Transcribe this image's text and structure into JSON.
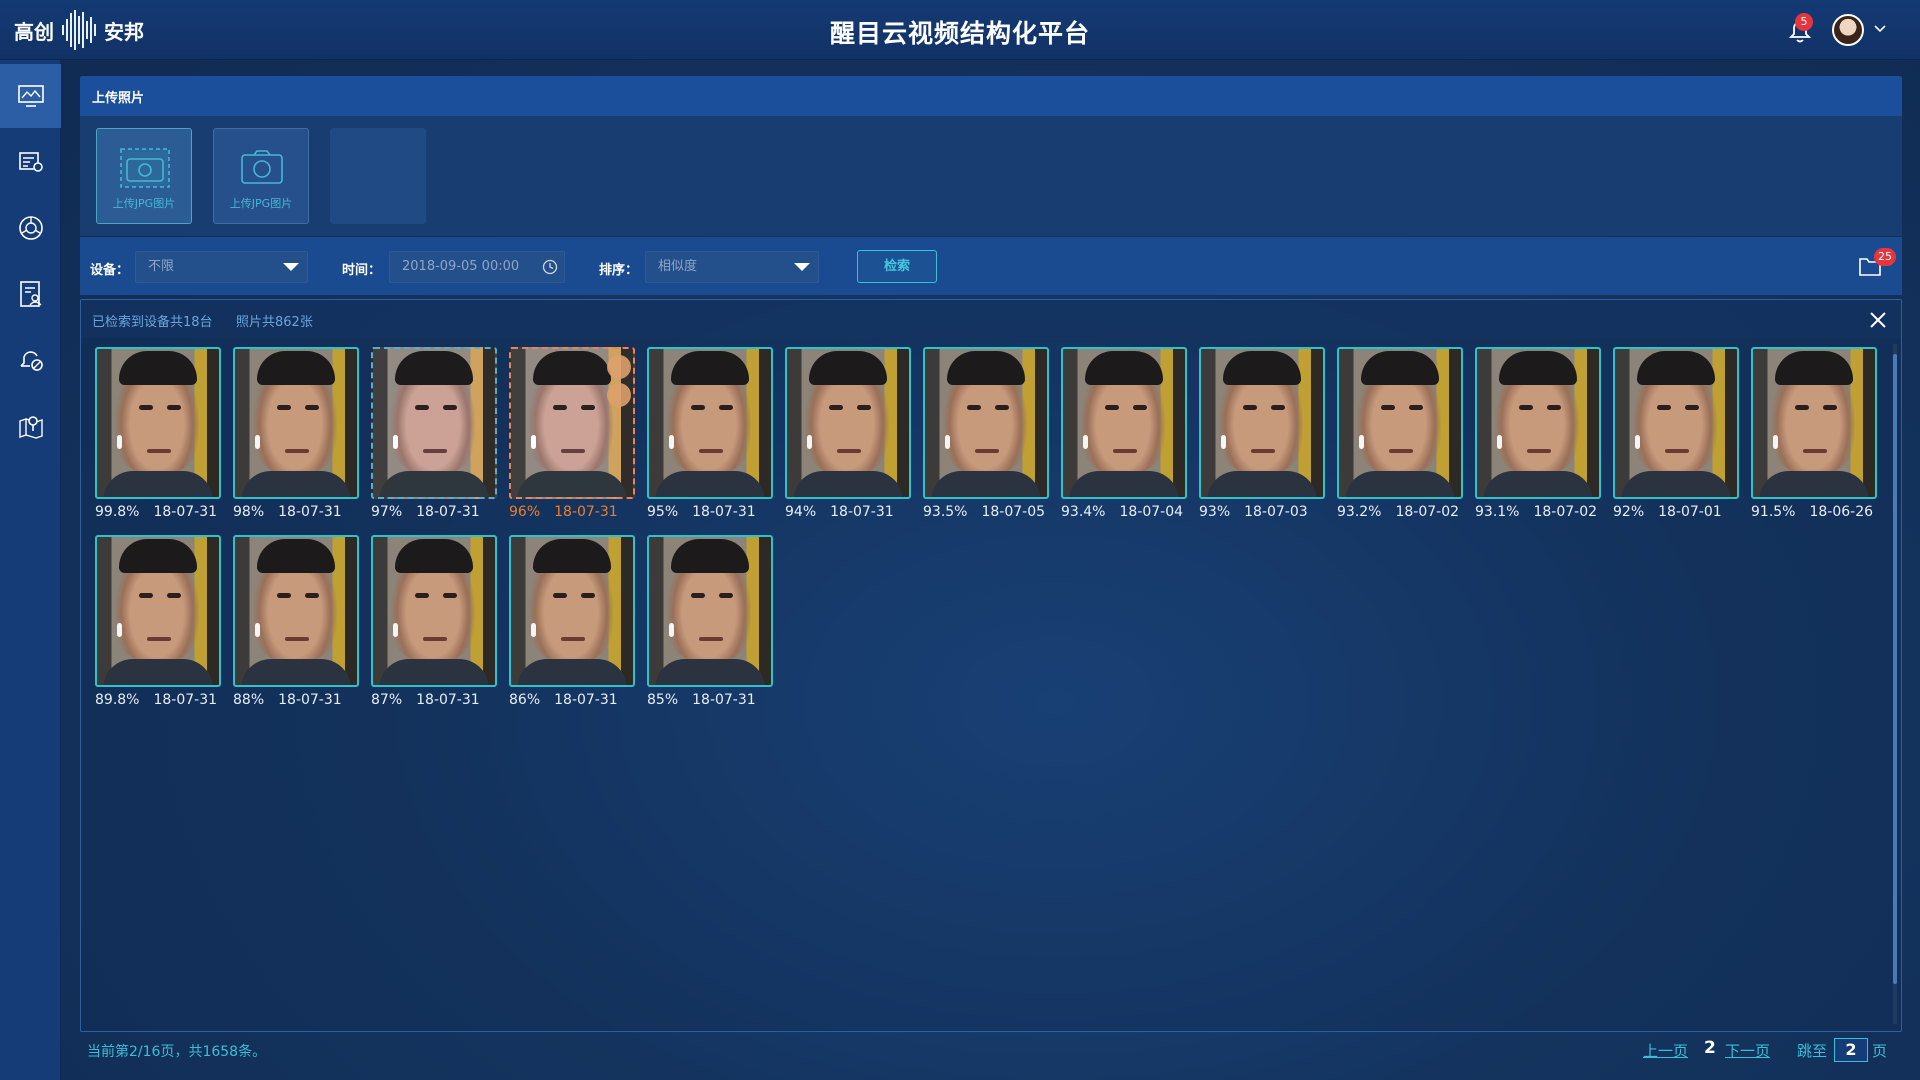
{
  "header": {
    "logo_left": "高创",
    "logo_right": "安邦",
    "title": "醒目云视频结构化平台",
    "notification_count": "5"
  },
  "sidebar": {
    "items": [
      "monitor-icon",
      "device-settings-icon",
      "face-recognition-icon",
      "profile-list-icon",
      "alarm-icon",
      "map-pin-icon"
    ],
    "active_index": 0
  },
  "upload": {
    "section_title": "上传照片",
    "tiles": [
      {
        "caption": "上传JPG图片",
        "icon": "dashed-camera-icon"
      },
      {
        "caption": "上传JPG图片",
        "icon": "camera-icon"
      },
      {
        "caption": "",
        "icon": ""
      }
    ]
  },
  "filters": {
    "device_label": "设备：",
    "device_value": "不限",
    "time_label": "时间：",
    "time_value": "2018-09-05  00:00",
    "sort_label": "排序：",
    "sort_value": "相似度",
    "search_button": "检索",
    "folder_count": "25"
  },
  "results": {
    "summary_devices": "已检索到设备共18台",
    "summary_photos": "照片共862张",
    "items": [
      {
        "similarity": "99.8%",
        "date": "18-07-31"
      },
      {
        "similarity": "98%",
        "date": "18-07-31"
      },
      {
        "similarity": "97%",
        "date": "18-07-31"
      },
      {
        "similarity": "96%",
        "date": "18-07-31"
      },
      {
        "similarity": "95%",
        "date": "18-07-31"
      },
      {
        "similarity": "94%",
        "date": "18-07-31"
      },
      {
        "similarity": "93.5%",
        "date": "18-07-05"
      },
      {
        "similarity": "93.4%",
        "date": "18-07-04"
      },
      {
        "similarity": "93%",
        "date": "18-07-03"
      },
      {
        "similarity": "93.2%",
        "date": "18-07-02"
      },
      {
        "similarity": "93.1%",
        "date": "18-07-02"
      },
      {
        "similarity": "92%",
        "date": "18-07-01"
      },
      {
        "similarity": "91.5%",
        "date": "18-06-26"
      },
      {
        "similarity": "89.8%",
        "date": "18-07-31"
      },
      {
        "similarity": "88%",
        "date": "18-07-31"
      },
      {
        "similarity": "87%",
        "date": "18-07-31"
      },
      {
        "similarity": "86%",
        "date": "18-07-31"
      },
      {
        "similarity": "85%",
        "date": "18-07-31"
      }
    ]
  },
  "footer": {
    "page_info": "当前第2/16页，共1658条。",
    "prev": "上一页",
    "current": "2",
    "next": "下一页",
    "jump_label": "跳至",
    "jump_value": "2",
    "page_suffix": "页"
  },
  "colors": {
    "accent": "#3bbfd6",
    "selected_orange": "#f07d2c",
    "badge_red": "#e5363d"
  }
}
